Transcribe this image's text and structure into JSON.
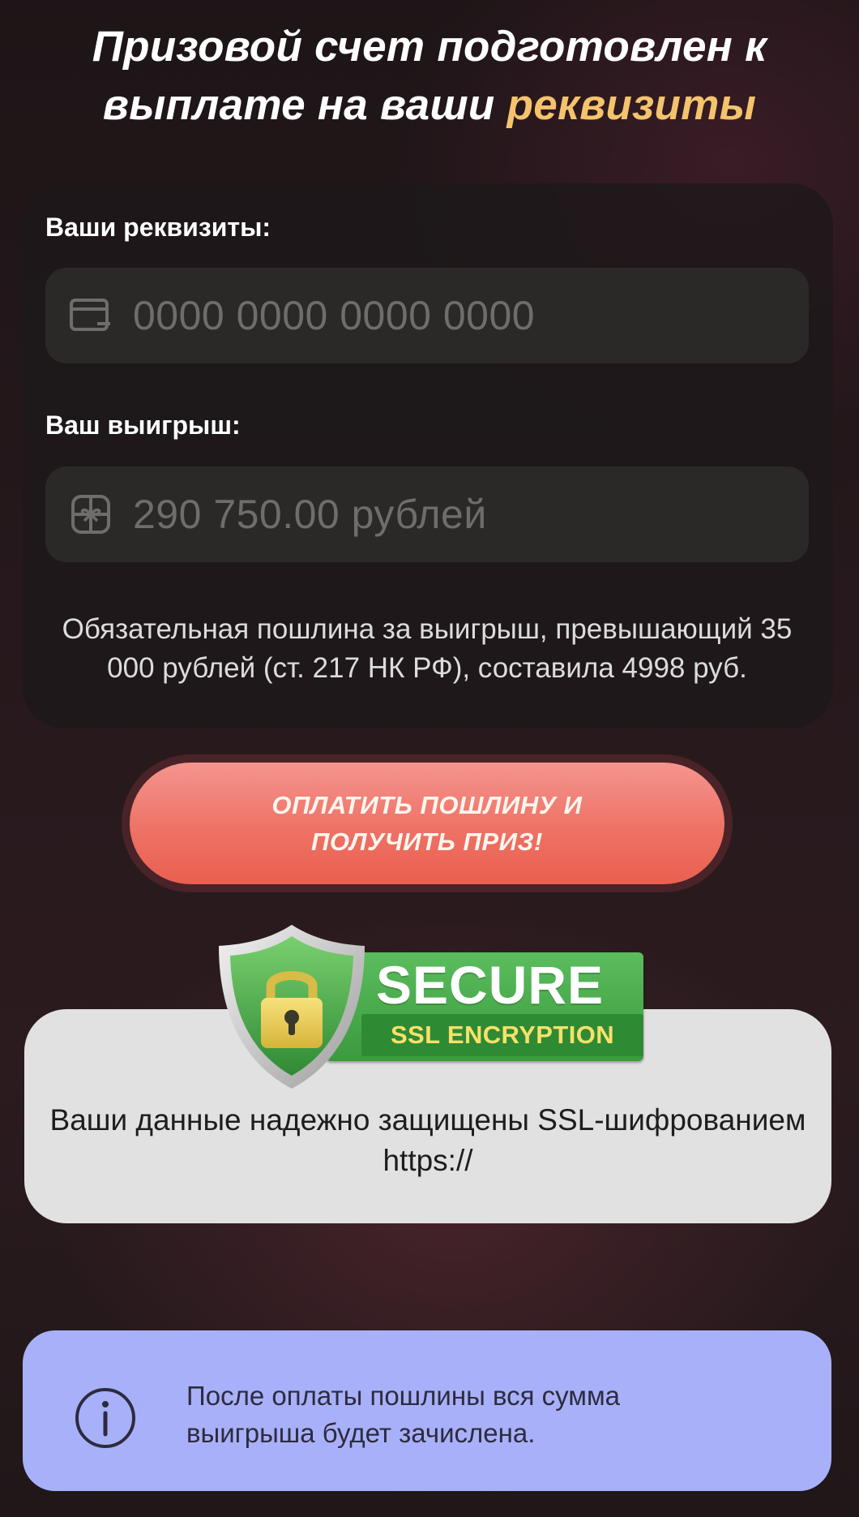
{
  "header": {
    "title_main": "Призовой счет подготовлен к выплате на ваши",
    "title_accent": "реквизиты"
  },
  "details": {
    "requisites_label": "Ваши реквизиты:",
    "card_placeholder": "0000 0000 0000 0000",
    "card_icon": "credit-card-icon",
    "winnings_label": "Ваш выигрыш:",
    "winnings_value": "290 750.00 рублей",
    "winnings_icon": "gift-icon",
    "fee_notice": "Обязательная пошлина за выигрыш, превышающий 35 000 рублей (ст. 217 НК РФ), составила 4998 руб."
  },
  "pay_button": {
    "label": "ОПЛАТИТЬ ПОШЛИНУ И ПОЛУЧИТЬ ПРИЗ!"
  },
  "security": {
    "badge_title": "SECURE",
    "badge_subtitle": "SSL ENCRYPTION",
    "badge_icon": "shield-lock-icon",
    "text": "Ваши данные надежно защищены SSL-шифрованием https://"
  },
  "info": {
    "icon": "info-icon",
    "text": "После оплаты пошлины вся сумма выигрыша будет зачислена."
  },
  "colors": {
    "accent": "#f4c36c",
    "button": "#ee7266",
    "badge_green": "#3a9a3d",
    "info_bg": "#a9b0fa"
  }
}
